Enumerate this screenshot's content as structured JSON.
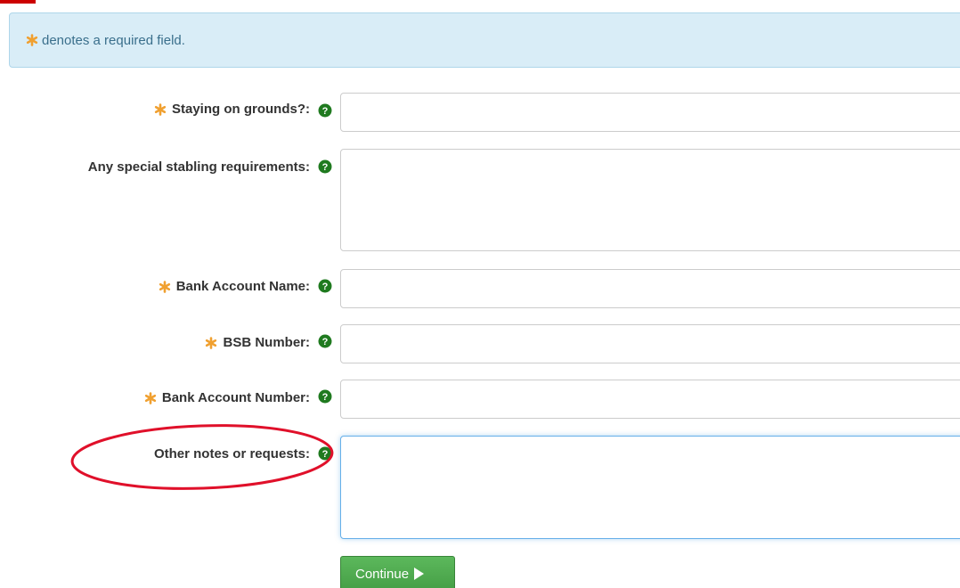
{
  "notice": {
    "text": "denotes a required field."
  },
  "form": {
    "staying_on_grounds": {
      "label": "Staying on grounds?:",
      "value": ""
    },
    "stabling_requirements": {
      "label": "Any special stabling requirements:",
      "value": ""
    },
    "bank_account_name": {
      "label": "Bank Account Name:",
      "value": ""
    },
    "bsb_number": {
      "label": "BSB Number:",
      "value": ""
    },
    "bank_account_number": {
      "label": "Bank Account Number:",
      "value": ""
    },
    "other_notes": {
      "label": "Other notes or requests:",
      "value": ""
    }
  },
  "actions": {
    "continue_label": "Continue"
  },
  "colors": {
    "required_asterisk": "#f0a030",
    "help_icon": "#1f7a1f",
    "annotation_ellipse": "#e0102a",
    "continue_button": "#5cb85c",
    "notice_background": "#d9edf7"
  },
  "icons": {
    "required": "asterisk-icon",
    "help": "help-question-icon",
    "continue": "play-arrow-icon"
  }
}
